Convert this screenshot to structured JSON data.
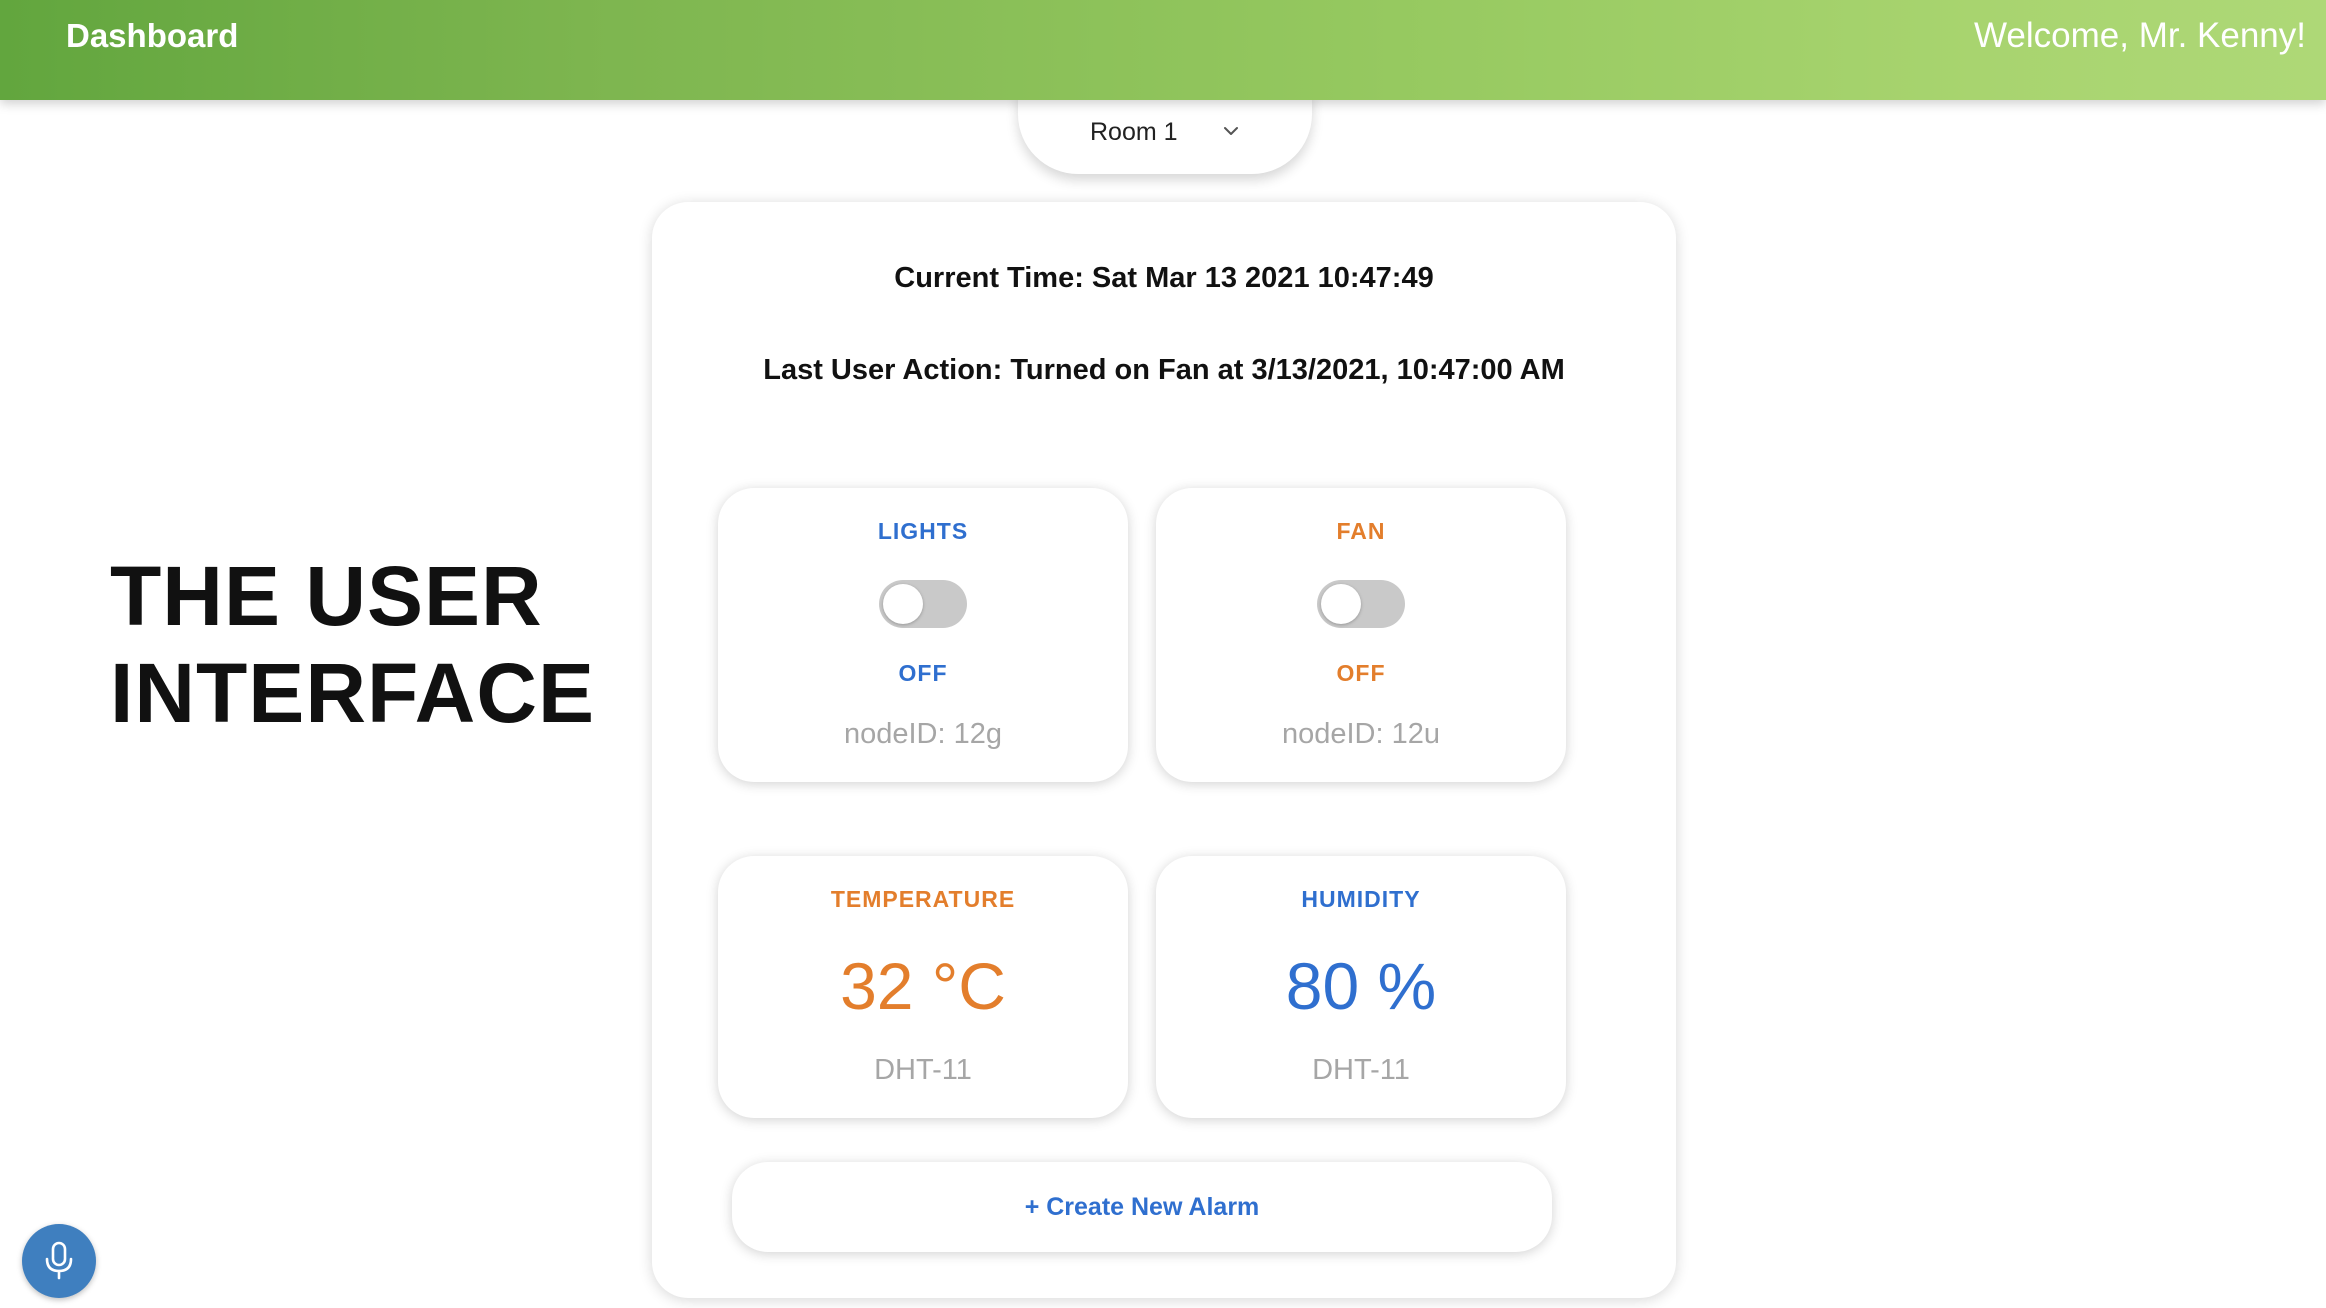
{
  "header": {
    "title": "Dashboard",
    "welcome": "Welcome, Mr. Kenny!"
  },
  "room_selector": {
    "selected": "Room 1",
    "icon": "chevron-down-icon"
  },
  "side_title": {
    "line1": "THE USER",
    "line2": "INTERFACE"
  },
  "panel": {
    "current_time": "Current Time: Sat Mar 13 2021 10:47:49",
    "last_action": "Last User Action: Turned on Fan at 3/13/2021, 10:47:00 AM"
  },
  "cards": {
    "lights": {
      "title": "LIGHTS",
      "state": "OFF",
      "node": "nodeID: 12g",
      "toggle_on": false,
      "color": "#2f6fcf"
    },
    "fan": {
      "title": "FAN",
      "state": "OFF",
      "node": "nodeID: 12u",
      "toggle_on": false,
      "color": "#e37e2c"
    },
    "temperature": {
      "title": "TEMPERATURE",
      "value": "32 °C",
      "sensor": "DHT-11",
      "color": "#e37e2c"
    },
    "humidity": {
      "title": "HUMIDITY",
      "value": "80 %",
      "sensor": "DHT-11",
      "color": "#2f6fcf"
    }
  },
  "alarm_button": {
    "label": "+ Create New Alarm"
  },
  "mic_button": {
    "icon": "microphone-icon"
  },
  "colors": {
    "header_start": "#62a63e",
    "header_end": "#aed877",
    "accent_blue": "#2f6fcf",
    "accent_orange": "#e37e2c",
    "mic_blue": "#3f7fbf"
  }
}
